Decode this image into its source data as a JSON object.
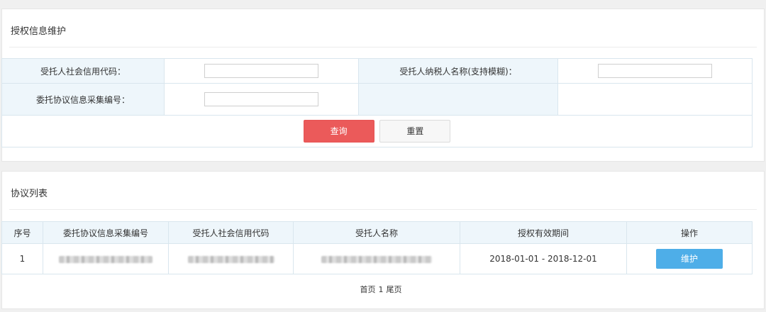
{
  "search_panel": {
    "title": "授权信息维护",
    "fields": {
      "credit_code_label": "受托人社会信用代码：",
      "credit_code_value": "",
      "taxpayer_name_label": "受托人纳税人名称(支持模糊)：",
      "taxpayer_name_value": "",
      "agreement_no_label": "委托协议信息采集编号：",
      "agreement_no_value": ""
    },
    "query_button": "查询",
    "reset_button": "重置"
  },
  "list_panel": {
    "title": "协议列表",
    "columns": [
      "序号",
      "委托协议信息采集编号",
      "受托人社会信用代码",
      "受托人名称",
      "授权有效期间",
      "操作"
    ],
    "rows": [
      {
        "index": "1",
        "period": "2018-01-01 - 2018-12-01",
        "action": "维护"
      }
    ],
    "pagination": {
      "first": "首页",
      "page": "1",
      "last": "尾页"
    }
  }
}
